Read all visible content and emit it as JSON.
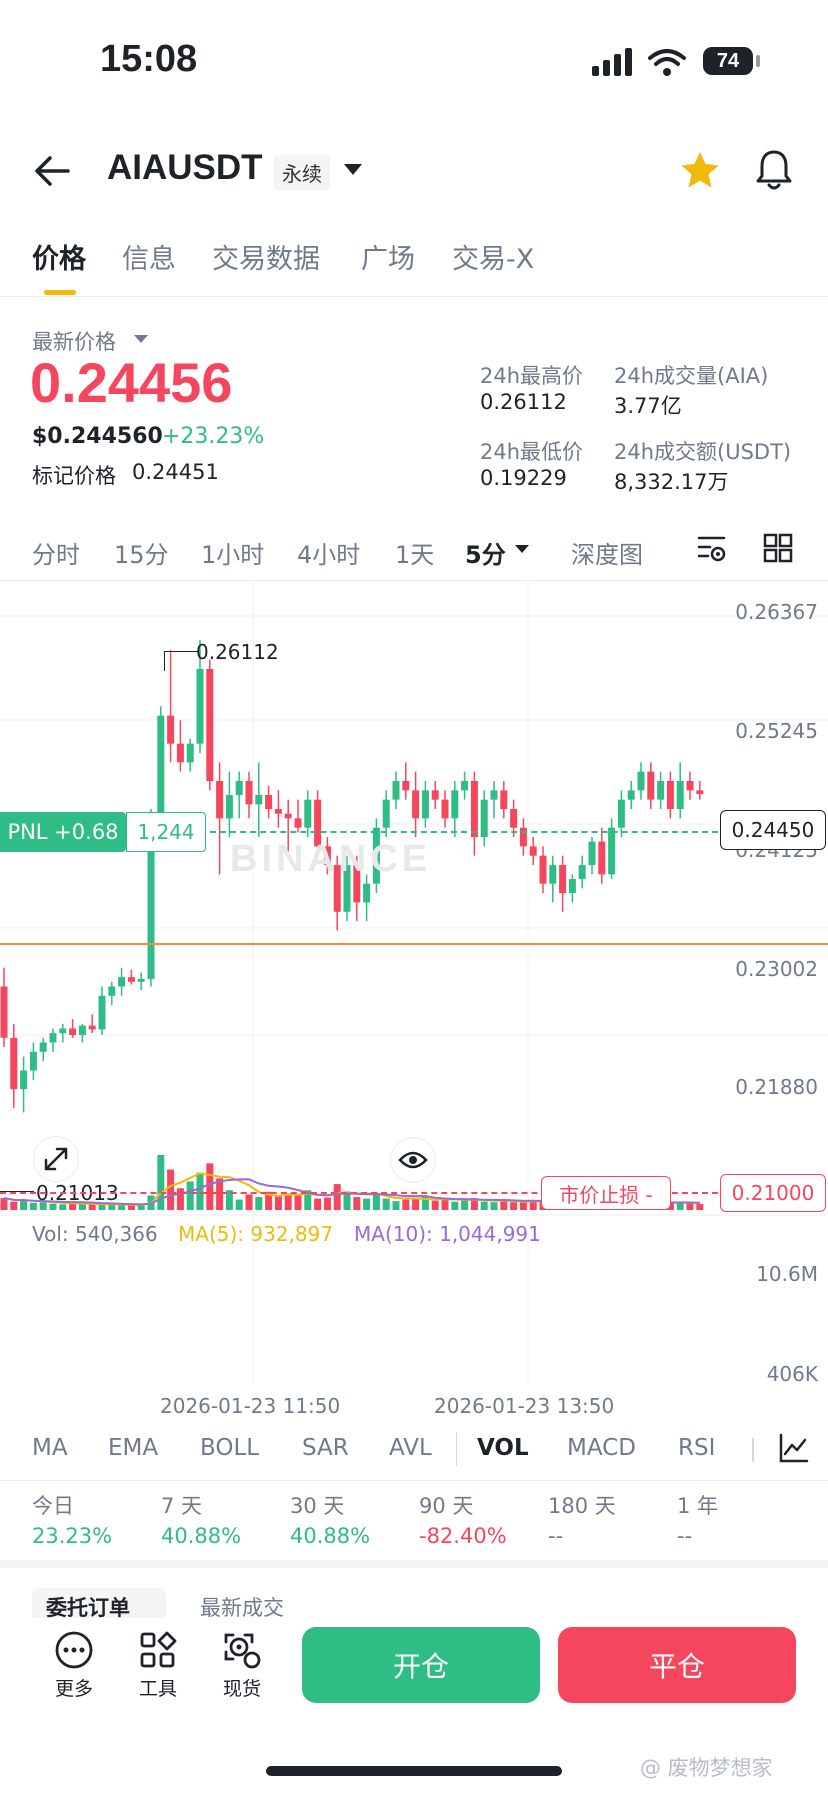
{
  "status": {
    "time": "15:08",
    "battery": "74"
  },
  "header": {
    "symbol": "AIAUSDT",
    "type": "永续"
  },
  "tabs": [
    {
      "label": "价格",
      "active": true
    },
    {
      "label": "信息"
    },
    {
      "label": "交易数据"
    },
    {
      "label": "广场"
    },
    {
      "label": "交易-X"
    }
  ],
  "price": {
    "label": "最新价格",
    "last": "0.24456",
    "usd": "$0.244560",
    "change": "+23.23%",
    "mark_label": "标记价格",
    "mark": "0.24451"
  },
  "stats": {
    "high_label": "24h最高价",
    "high": "0.26112",
    "low_label": "24h最低价",
    "low": "0.19229",
    "vol_label": "24h成交量(AIA)",
    "vol": "3.77亿",
    "amt_label": "24h成交额(USDT)",
    "amt": "8,332.17万"
  },
  "timeframes": [
    {
      "label": "分时"
    },
    {
      "label": "15分"
    },
    {
      "label": "1小时"
    },
    {
      "label": "4小时"
    },
    {
      "label": "1天"
    },
    {
      "label": "5分",
      "active": true
    },
    {
      "label": "深度图"
    }
  ],
  "chart": {
    "price_axis": [
      "0.26367",
      "0.25245",
      "0.24125",
      "0.23002",
      "0.21880"
    ],
    "high_marker": "0.26112",
    "low_marker": "0.21013",
    "current_price_tag": "0.24450",
    "pnl_label": "PNL +0.68",
    "pnl_qty": "1,244",
    "watermark": "BINANCE",
    "stop_label": "市价止损 -",
    "stop_price": "0.21000",
    "vol_axis_top": "10.6M",
    "vol_axis_bottom": "406K",
    "time_labels": [
      "2026-01-23 11:50",
      "2026-01-23 13:50"
    ]
  },
  "vol_legend": {
    "vol": "Vol: 540,366",
    "ma5": "MA(5): 932,897",
    "ma10": "MA(10): 1,044,991",
    "ma5_color": "#f0b90b",
    "ma10_color": "#9a6bd1"
  },
  "indicators": [
    {
      "label": "MA"
    },
    {
      "label": "EMA"
    },
    {
      "label": "BOLL"
    },
    {
      "label": "SAR"
    },
    {
      "label": "AVL"
    },
    {
      "label": "VOL",
      "active": true
    },
    {
      "label": "MACD"
    },
    {
      "label": "RSI"
    }
  ],
  "periods": [
    {
      "label": "今日",
      "value": "23.23%",
      "tone": "green"
    },
    {
      "label": "7 天",
      "value": "40.88%",
      "tone": "green"
    },
    {
      "label": "30 天",
      "value": "40.88%",
      "tone": "green"
    },
    {
      "label": "90 天",
      "value": "-82.40%",
      "tone": "red"
    },
    {
      "label": "180 天",
      "value": "--",
      "tone": "gray"
    },
    {
      "label": "1 年",
      "value": "--",
      "tone": "gray"
    }
  ],
  "bottom_tabs_partial": [
    "委托订单",
    "最新成交"
  ],
  "bottom": {
    "more": "更多",
    "tools": "工具",
    "spot": "现货",
    "open": "开仓",
    "close": "平仓"
  },
  "watermark_user": "@ 废物梦想家",
  "colors": {
    "up": "#2ebd85",
    "down": "#f6465d",
    "accent": "#f0b90b"
  },
  "chart_data": {
    "type": "candlestick",
    "interval": "5分",
    "candles": [
      [
        0.224,
        0.226,
        0.2175,
        0.2185
      ],
      [
        0.2185,
        0.22,
        0.211,
        0.213
      ],
      [
        0.213,
        0.2165,
        0.2105,
        0.215
      ],
      [
        0.215,
        0.218,
        0.214,
        0.217
      ],
      [
        0.217,
        0.2185,
        0.216,
        0.218
      ],
      [
        0.218,
        0.2195,
        0.217,
        0.219
      ],
      [
        0.219,
        0.22,
        0.218,
        0.2195
      ],
      [
        0.2195,
        0.2205,
        0.2185,
        0.2188
      ],
      [
        0.2188,
        0.22,
        0.218,
        0.2198
      ],
      [
        0.2198,
        0.221,
        0.219,
        0.2194
      ],
      [
        0.2194,
        0.224,
        0.2188,
        0.223
      ],
      [
        0.223,
        0.2245,
        0.222,
        0.224
      ],
      [
        0.224,
        0.226,
        0.223,
        0.225
      ],
      [
        0.225,
        0.2258,
        0.2242,
        0.2245
      ],
      [
        0.2245,
        0.2255,
        0.2236,
        0.2248
      ],
      [
        0.2248,
        0.243,
        0.224,
        0.242
      ],
      [
        0.242,
        0.254,
        0.24,
        0.253
      ],
      [
        0.253,
        0.26,
        0.248,
        0.25
      ],
      [
        0.25,
        0.2525,
        0.247,
        0.248
      ],
      [
        0.248,
        0.2505,
        0.247,
        0.25
      ],
      [
        0.25,
        0.2611,
        0.249,
        0.258
      ],
      [
        0.258,
        0.259,
        0.245,
        0.246
      ],
      [
        0.246,
        0.248,
        0.236,
        0.242
      ],
      [
        0.242,
        0.247,
        0.24,
        0.2445
      ],
      [
        0.2445,
        0.247,
        0.242,
        0.246
      ],
      [
        0.246,
        0.247,
        0.242,
        0.2435
      ],
      [
        0.2435,
        0.248,
        0.24,
        0.2445
      ],
      [
        0.2445,
        0.2455,
        0.242,
        0.243
      ],
      [
        0.243,
        0.245,
        0.241,
        0.2425
      ],
      [
        0.2425,
        0.244,
        0.238,
        0.242
      ],
      [
        0.242,
        0.244,
        0.2405,
        0.241
      ],
      [
        0.241,
        0.245,
        0.24,
        0.244
      ],
      [
        0.244,
        0.245,
        0.238,
        0.239
      ],
      [
        0.239,
        0.24,
        0.236,
        0.237
      ],
      [
        0.237,
        0.238,
        0.23,
        0.232
      ],
      [
        0.232,
        0.238,
        0.231,
        0.237
      ],
      [
        0.237,
        0.238,
        0.231,
        0.233
      ],
      [
        0.233,
        0.236,
        0.231,
        0.235
      ],
      [
        0.235,
        0.242,
        0.234,
        0.241
      ],
      [
        0.241,
        0.245,
        0.24,
        0.244
      ],
      [
        0.244,
        0.247,
        0.243,
        0.246
      ],
      [
        0.246,
        0.248,
        0.244,
        0.245
      ],
      [
        0.245,
        0.247,
        0.24,
        0.242
      ],
      [
        0.242,
        0.246,
        0.241,
        0.245
      ],
      [
        0.245,
        0.246,
        0.243,
        0.244
      ],
      [
        0.244,
        0.245,
        0.241,
        0.242
      ],
      [
        0.242,
        0.246,
        0.24,
        0.245
      ],
      [
        0.245,
        0.247,
        0.244,
        0.246
      ],
      [
        0.246,
        0.247,
        0.238,
        0.24
      ],
      [
        0.24,
        0.245,
        0.239,
        0.244
      ],
      [
        0.244,
        0.246,
        0.242,
        0.245
      ],
      [
        0.245,
        0.246,
        0.242,
        0.243
      ],
      [
        0.243,
        0.244,
        0.24,
        0.241
      ],
      [
        0.241,
        0.242,
        0.238,
        0.239
      ],
      [
        0.239,
        0.24,
        0.237,
        0.238
      ],
      [
        0.238,
        0.239,
        0.234,
        0.235
      ],
      [
        0.235,
        0.238,
        0.233,
        0.237
      ],
      [
        0.237,
        0.238,
        0.232,
        0.234
      ],
      [
        0.234,
        0.236,
        0.233,
        0.2355
      ],
      [
        0.2355,
        0.238,
        0.2345,
        0.237
      ],
      [
        0.237,
        0.24,
        0.236,
        0.2395
      ],
      [
        0.2395,
        0.241,
        0.235,
        0.236
      ],
      [
        0.236,
        0.242,
        0.2355,
        0.241
      ],
      [
        0.241,
        0.245,
        0.24,
        0.244
      ],
      [
        0.244,
        0.246,
        0.243,
        0.245
      ],
      [
        0.245,
        0.248,
        0.244,
        0.247
      ],
      [
        0.247,
        0.248,
        0.243,
        0.244
      ],
      [
        0.244,
        0.247,
        0.243,
        0.246
      ],
      [
        0.246,
        0.247,
        0.242,
        0.243
      ],
      [
        0.243,
        0.248,
        0.242,
        0.246
      ],
      [
        0.246,
        0.247,
        0.244,
        0.245
      ],
      [
        0.245,
        0.246,
        0.244,
        0.2446
      ]
    ],
    "volume_scale_max": 10600000,
    "volumes": [
      2.3,
      1.6,
      1.8,
      1.4,
      1.5,
      1.2,
      1.1,
      1.3,
      1.2,
      1.1,
      1.0,
      1.1,
      0.9,
      1.0,
      0.9,
      2.8,
      10.6,
      7.8,
      4.2,
      5.5,
      7.2,
      9.0,
      6.1,
      3.8,
      2.0,
      3.0,
      2.5,
      3.5,
      2.6,
      3.2,
      2.8,
      3.8,
      2.2,
      2.4,
      5.0,
      3.6,
      2.5,
      2.2,
      3.0,
      2.2,
      1.7,
      2.0,
      2.2,
      2.5,
      1.8,
      2.0,
      1.6,
      2.0,
      2.3,
      1.6,
      1.5,
      1.8,
      1.5,
      1.6,
      1.9,
      1.5,
      1.4,
      1.7,
      1.6,
      1.5,
      1.4,
      1.6,
      1.3,
      1.5,
      1.6,
      1.4,
      1.5,
      1.4,
      1.3,
      1.5,
      1.3,
      1.2
    ]
  }
}
